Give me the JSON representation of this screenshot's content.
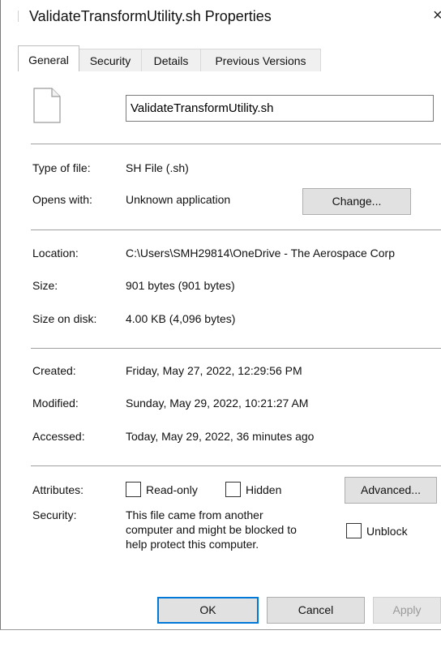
{
  "window": {
    "title": "ValidateTransformUtility.sh Properties",
    "close_glyph": "×"
  },
  "tabs": [
    {
      "label": "General",
      "active": true
    },
    {
      "label": "Security",
      "active": false
    },
    {
      "label": "Details",
      "active": false
    },
    {
      "label": "Previous Versions",
      "active": false
    }
  ],
  "file": {
    "name": "ValidateTransformUtility.sh",
    "icon": "file-icon"
  },
  "type_of_file": {
    "label": "Type of file:",
    "value": "SH File (.sh)"
  },
  "opens_with": {
    "label": "Opens with:",
    "value": "Unknown application",
    "button": "Change..."
  },
  "location": {
    "label": "Location:",
    "value": "C:\\Users\\SMH29814\\OneDrive - The Aerospace Corp"
  },
  "size": {
    "label": "Size:",
    "value": "901 bytes (901 bytes)"
  },
  "size_on_disk": {
    "label": "Size on disk:",
    "value": "4.00 KB (4,096 bytes)"
  },
  "created": {
    "label": "Created:",
    "value": "Friday, May 27, 2022, 12:29:56 PM"
  },
  "modified": {
    "label": "Modified:",
    "value": "Sunday, May 29, 2022, 10:21:27 AM"
  },
  "accessed": {
    "label": "Accessed:",
    "value": "Today, May 29, 2022, 36 minutes ago"
  },
  "attributes": {
    "label": "Attributes:",
    "readonly": {
      "label": "Read-only",
      "checked": false
    },
    "hidden": {
      "label": "Hidden",
      "checked": false
    },
    "advanced_button": "Advanced..."
  },
  "security": {
    "label": "Security:",
    "lines": [
      "This file came from another",
      "computer and might be blocked to",
      "help protect this computer."
    ],
    "unblock": {
      "label": "Unblock",
      "checked": false
    }
  },
  "footer": {
    "ok": "OK",
    "cancel": "Cancel",
    "apply": "Apply"
  },
  "colors": {
    "accent": "#0078d7",
    "button_bg": "#e1e1e1",
    "separator": "#a0a0a0"
  }
}
